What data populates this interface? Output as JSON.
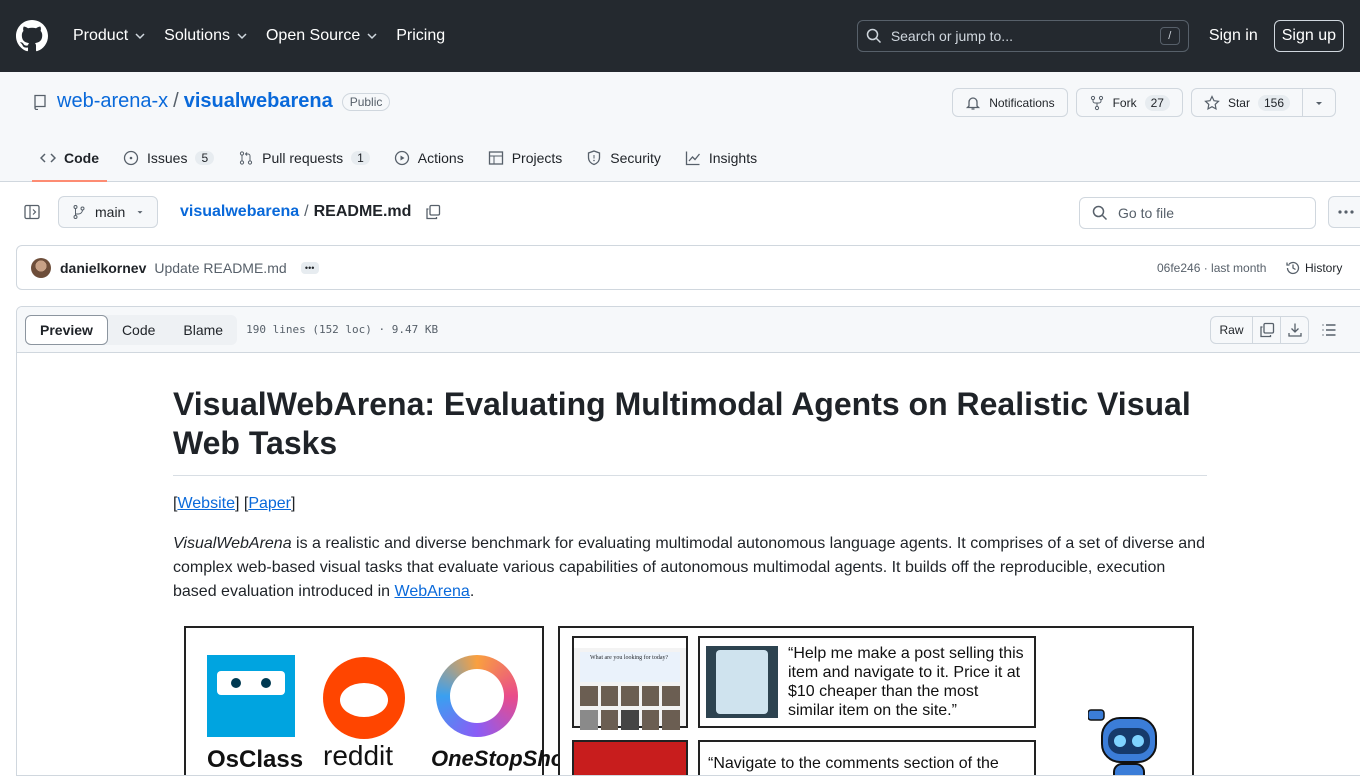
{
  "topnav": {
    "items": [
      "Product",
      "Solutions",
      "Open Source",
      "Pricing"
    ],
    "search_placeholder": "Search or jump to...",
    "search_shortcut": "/",
    "signin": "Sign in",
    "signup": "Sign up"
  },
  "repo": {
    "owner": "web-arena-x",
    "name": "visualwebarena",
    "visibility": "Public",
    "notifications": "Notifications",
    "fork_label": "Fork",
    "fork_count": "27",
    "star_label": "Star",
    "star_count": "156"
  },
  "tabs": [
    {
      "label": "Code",
      "count": ""
    },
    {
      "label": "Issues",
      "count": "5"
    },
    {
      "label": "Pull requests",
      "count": "1"
    },
    {
      "label": "Actions",
      "count": ""
    },
    {
      "label": "Projects",
      "count": ""
    },
    {
      "label": "Security",
      "count": ""
    },
    {
      "label": "Insights",
      "count": ""
    }
  ],
  "filenav": {
    "branch": "main",
    "repo_crumb": "visualwebarena",
    "sep": "/",
    "file": "README.md",
    "goto_placeholder": "Go to file"
  },
  "commit": {
    "author": "danielkornev",
    "message": "Update README.md",
    "hash_time": "06fe246 · last month",
    "history": "History"
  },
  "filebox": {
    "modes": [
      "Preview",
      "Code",
      "Blame"
    ],
    "info": "190 lines (152 loc) · 9.47 KB",
    "raw": "Raw"
  },
  "readme": {
    "title": "VisualWebArena: Evaluating Multimodal Agents on Realistic Visual Web Tasks",
    "link_website": "Website",
    "link_paper": "Paper",
    "intro_em": "VisualWebArena",
    "intro_text": " is a realistic and diverse benchmark for evaluating multimodal autonomous language agents. It comprises of a set of diverse and complex web-based visual tasks that evaluate various capabilities of autonomous multimodal agents. It builds off the reproducible, execution based evaluation introduced in ",
    "intro_link": "WebArena",
    "intro_end": ".",
    "figure": {
      "logos": [
        "OsClass",
        "reddit",
        "OneStopShop"
      ],
      "shot1_caption": "What are you looking for today?",
      "quote1": "“Help me make a post selling this item and navigate to it. Price it at $10 cheaper than the most similar item on the site.”",
      "quote2": "“Navigate to the comments section of the"
    }
  },
  "colors": {
    "header_bg": "#24292f",
    "link": "#0969da",
    "active_tab_underline": "#fd8c73"
  }
}
